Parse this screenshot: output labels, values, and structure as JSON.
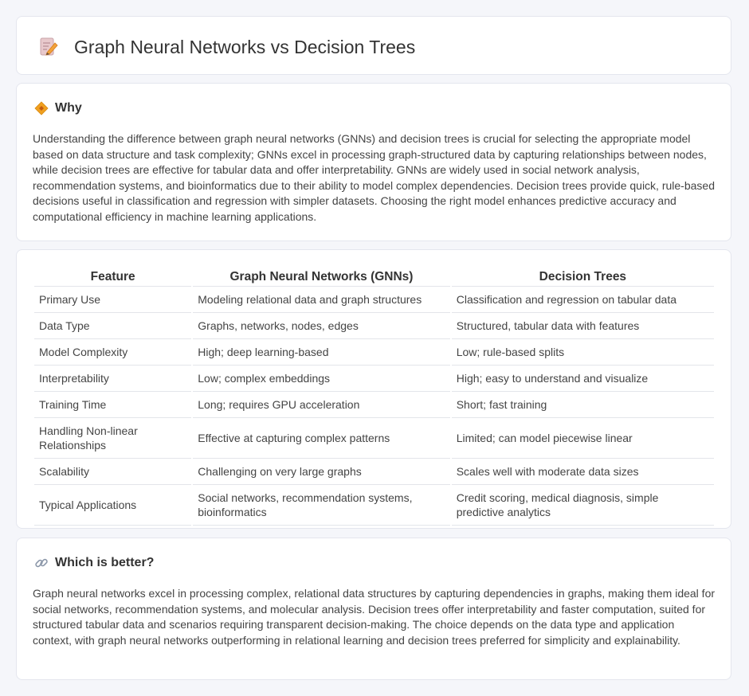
{
  "header": {
    "title": "Graph Neural Networks vs Decision Trees",
    "icon": "pencil-document-icon"
  },
  "why": {
    "heading": "Why",
    "icon": "diamond-sign-icon",
    "text": "Understanding the difference between graph neural networks (GNNs) and decision trees is crucial for selecting the appropriate model based on data structure and task complexity; GNNs excel in processing graph-structured data by capturing relationships between nodes, while decision trees are effective for tabular data and offer interpretability. GNNs are widely used in social network analysis, recommendation systems, and bioinformatics due to their ability to model complex dependencies. Decision trees provide quick, rule-based decisions useful in classification and regression with simpler datasets. Choosing the right model enhances predictive accuracy and computational efficiency in machine learning applications."
  },
  "table": {
    "headers": [
      "Feature",
      "Graph Neural Networks (GNNs)",
      "Decision Trees"
    ],
    "rows": [
      [
        "Primary Use",
        "Modeling relational data and graph structures",
        "Classification and regression on tabular data"
      ],
      [
        "Data Type",
        "Graphs, networks, nodes, edges",
        "Structured, tabular data with features"
      ],
      [
        "Model Complexity",
        "High; deep learning-based",
        "Low; rule-based splits"
      ],
      [
        "Interpretability",
        "Low; complex embeddings",
        "High; easy to understand and visualize"
      ],
      [
        "Training Time",
        "Long; requires GPU acceleration",
        "Short; fast training"
      ],
      [
        "Handling Non-linear Relationships",
        "Effective at capturing complex patterns",
        "Limited; can model piecewise linear"
      ],
      [
        "Scalability",
        "Challenging on very large graphs",
        "Scales well with moderate data sizes"
      ],
      [
        "Typical Applications",
        "Social networks, recommendation systems, bioinformatics",
        "Credit scoring, medical diagnosis, simple predictive analytics"
      ]
    ]
  },
  "better": {
    "heading": "Which is better?",
    "icon": "link-icon",
    "text": "Graph neural networks excel in processing complex, relational data structures by capturing dependencies in graphs, making them ideal for social networks, recommendation systems, and molecular analysis. Decision trees offer interpretability and faster computation, suited for structured tabular data and scenarios requiring transparent decision-making. The choice depends on the data type and application context, with graph neural networks outperforming in relational learning and decision trees preferred for simplicity and explainability."
  },
  "colors": {
    "background": "#f5f6fa",
    "card": "#ffffff",
    "border": "#e4e6ee",
    "accent_orange": "#f0a020"
  }
}
